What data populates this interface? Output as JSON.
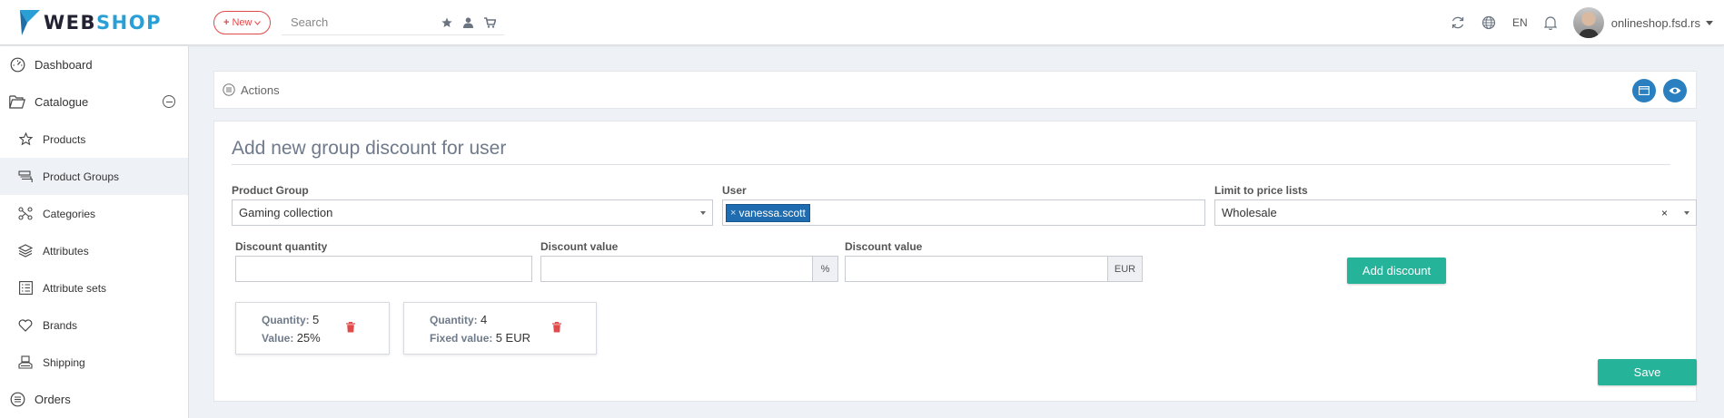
{
  "header": {
    "logo_web": "WEB",
    "logo_shop": "SHOP",
    "new_label": "New",
    "search_placeholder": "Search",
    "language": "EN",
    "user_name": "onlineshop.fsd.rs"
  },
  "sidebar": {
    "items": [
      {
        "label": "Dashboard",
        "icon": "dashboard-icon"
      },
      {
        "label": "Catalogue",
        "icon": "folder-icon"
      },
      {
        "label": "Products",
        "icon": "star-icon"
      },
      {
        "label": "Product Groups",
        "icon": "stack-icon"
      },
      {
        "label": "Categories",
        "icon": "sitemap-icon"
      },
      {
        "label": "Attributes",
        "icon": "layers-icon"
      },
      {
        "label": "Attribute sets",
        "icon": "list-icon"
      },
      {
        "label": "Brands",
        "icon": "heart-icon"
      },
      {
        "label": "Shipping",
        "icon": "shipping-icon"
      },
      {
        "label": "Orders",
        "icon": "orders-icon"
      }
    ]
  },
  "actions": {
    "label": "Actions"
  },
  "form": {
    "title": "Add new group discount for user",
    "product_group": {
      "label": "Product Group",
      "value": "Gaming collection"
    },
    "user": {
      "label": "User",
      "tag": "vanessa.scott"
    },
    "price_lists": {
      "label": "Limit to price lists",
      "value": "Wholesale"
    },
    "discount_quantity": {
      "label": "Discount quantity",
      "value": ""
    },
    "discount_percent": {
      "label": "Discount value",
      "value": "",
      "unit": "%"
    },
    "discount_fixed": {
      "label": "Discount value",
      "value": "",
      "unit": "EUR"
    },
    "add_discount_label": "Add discount",
    "save_label": "Save"
  },
  "discounts": [
    {
      "qty_label": "Quantity:",
      "qty": "5",
      "val_label": "Value:",
      "val": "25%"
    },
    {
      "qty_label": "Quantity:",
      "qty": "4",
      "val_label": "Fixed value:",
      "val": "5 EUR"
    }
  ],
  "colors": {
    "accent": "#2a7fc1",
    "primary_green": "#25b39a",
    "danger": "#e14a4a",
    "tag": "#1f6db0"
  }
}
